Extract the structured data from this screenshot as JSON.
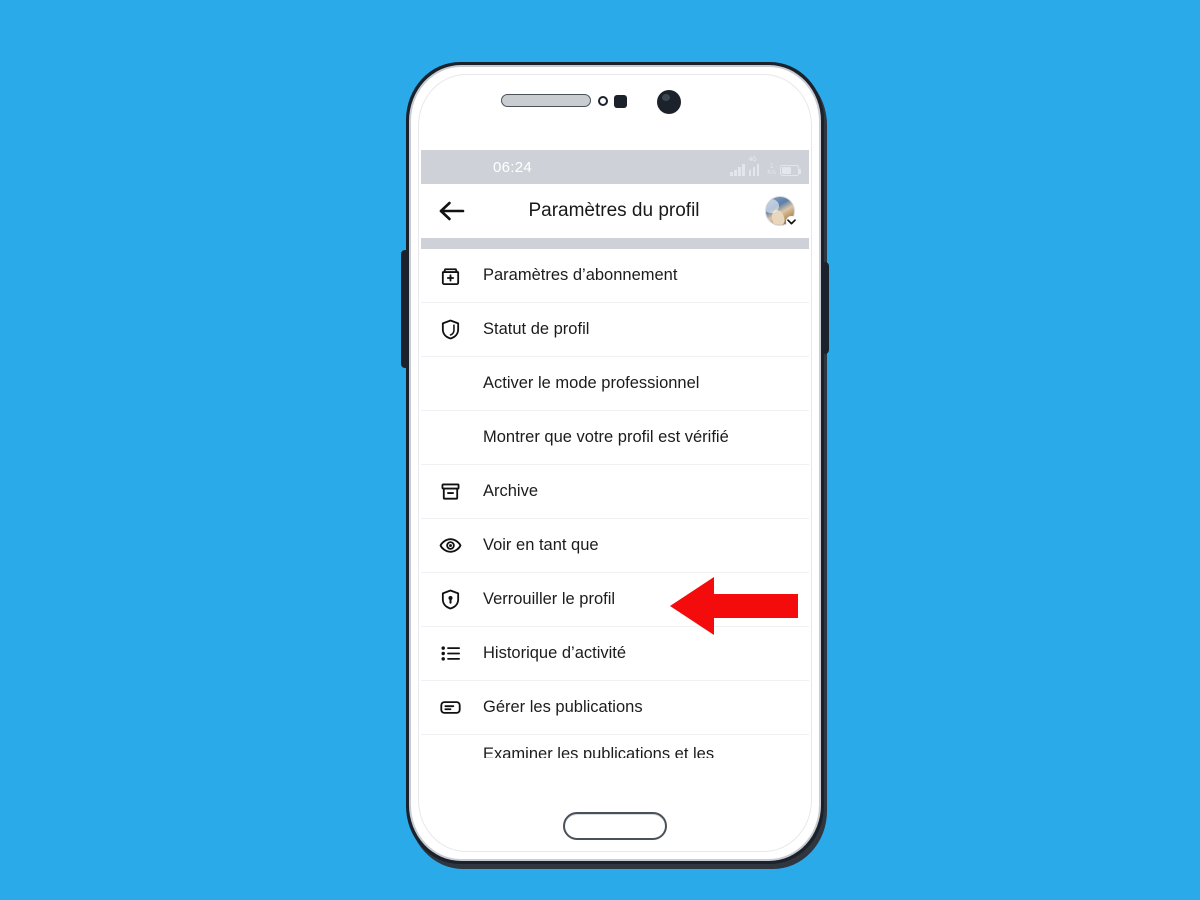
{
  "background_color": "#2BAAE9",
  "device": {
    "name": "android-smartphone-mockup",
    "frame_color": "#1C222B",
    "body_color": "#FFFFFF"
  },
  "statusbar": {
    "time": "06:24",
    "background_color": "#CED2D8",
    "network_label": "4G",
    "data_rate_value": "1",
    "data_rate_unit": "K/s",
    "icons": [
      "signal-bars-icon",
      "signal-bars-4g-icon",
      "data-rate-icon",
      "battery-icon"
    ]
  },
  "appbar": {
    "title": "Paramètres du profil",
    "back_icon": "back-arrow-icon",
    "avatar_icon": "avatar",
    "avatar_chevron_icon": "chevron-down-icon"
  },
  "menu": {
    "items": [
      {
        "label": "Paramètres d’abonnement",
        "icon": "subscription-box-plus-icon"
      },
      {
        "label": "Statut de profil",
        "icon": "shield-icon"
      },
      {
        "label": "Activer le mode professionnel",
        "icon": ""
      },
      {
        "label": "Montrer que votre profil est vérifié",
        "icon": ""
      },
      {
        "label": "Archive",
        "icon": "archive-box-icon"
      },
      {
        "label": "Voir en tant que",
        "icon": "eye-icon"
      },
      {
        "label": "Verrouiller le profil",
        "icon": "shield-lock-icon"
      },
      {
        "label": "Historique d’activité",
        "icon": "bulleted-list-icon"
      },
      {
        "label": "Gérer les publications",
        "icon": "post-card-icon"
      },
      {
        "label": "Examiner les publications et les identifications",
        "icon": ""
      }
    ]
  },
  "callout": {
    "arrow_icon": "left-pointing-arrow-icon",
    "arrow_color": "#F40B0B",
    "points_at": "Verrouiller le profil"
  }
}
